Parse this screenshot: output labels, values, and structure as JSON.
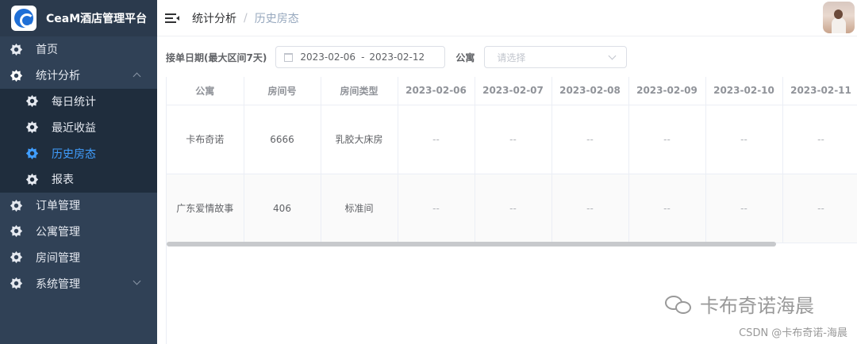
{
  "app": {
    "title": "CeaM酒店管理平台"
  },
  "sidebar": {
    "items": [
      {
        "label": "首页"
      },
      {
        "label": "统计分析"
      },
      {
        "label": "每日统计"
      },
      {
        "label": "最近收益"
      },
      {
        "label": "历史房态"
      },
      {
        "label": "报表"
      },
      {
        "label": "订单管理"
      },
      {
        "label": "公寓管理"
      },
      {
        "label": "房间管理"
      },
      {
        "label": "系统管理"
      }
    ]
  },
  "breadcrumb": {
    "parent": "统计分析",
    "sep": "/",
    "current": "历史房态"
  },
  "filters": {
    "date_label": "接单日期(最大区间7天)",
    "date_start": "2023-02-06",
    "date_end": "2023-02-12",
    "date_sep": "-",
    "apartment_label": "公寓",
    "apartment_placeholder": "请选择"
  },
  "table": {
    "headers": [
      "公寓",
      "房间号",
      "房间类型",
      "2023-02-06",
      "2023-02-07",
      "2023-02-08",
      "2023-02-09",
      "2023-02-10",
      "2023-02-11"
    ],
    "rows": [
      [
        "卡布奇诺",
        "6666",
        "乳胶大床房",
        "--",
        "--",
        "--",
        "--",
        "--",
        "--"
      ],
      [
        "广东爱情故事",
        "406",
        "标准间",
        "--",
        "--",
        "--",
        "--",
        "--",
        "--"
      ]
    ]
  },
  "watermark": {
    "text": "卡布奇诺海晨",
    "csdn": "CSDN @卡布奇诺-海晨"
  },
  "colors": {
    "sidebar_bg": "#304156",
    "submenu_bg": "#1f2d3d",
    "accent": "#409eff"
  }
}
